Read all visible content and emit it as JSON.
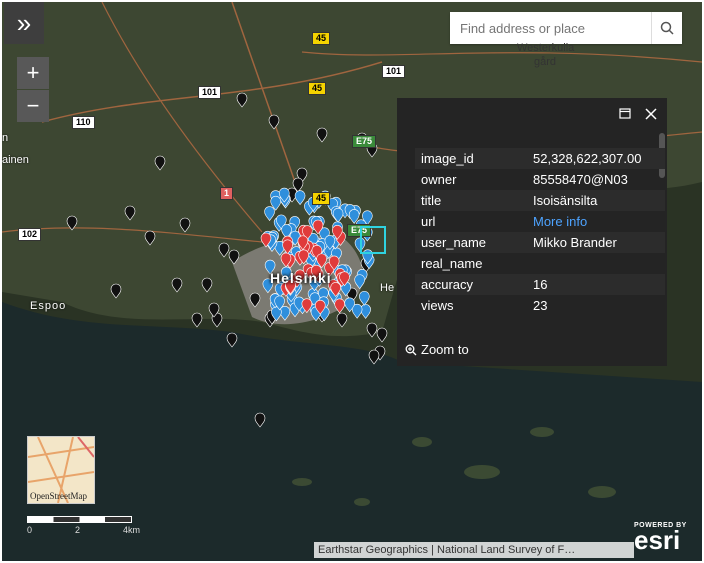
{
  "controls": {
    "expand_icon": "»",
    "zoom_in": "+",
    "zoom_out": "−"
  },
  "search": {
    "placeholder": "Find address or place"
  },
  "map_labels": {
    "helsinki": "Helsinki",
    "espoo": "Espoo",
    "westerkulla": "Westerkulla",
    "gard": "gård",
    "he": "He",
    "ainen": "ainen",
    "n": "n"
  },
  "road_shields": [
    "45",
    "101",
    "45",
    "101",
    "110",
    "45",
    "E75",
    "E75",
    "102",
    "1"
  ],
  "popup": {
    "rows": [
      {
        "key": "image_id",
        "value": "52,328,622,307.00"
      },
      {
        "key": "owner",
        "value": "85558470@N03"
      },
      {
        "key": "title",
        "value": "Isoisänsilta"
      },
      {
        "key": "url",
        "value": "More info"
      },
      {
        "key": "user_name",
        "value": "Mikko Brander"
      },
      {
        "key": "real_name",
        "value": ""
      },
      {
        "key": "accuracy",
        "value": "16"
      },
      {
        "key": "views",
        "value": "23"
      }
    ],
    "zoom_to": "Zoom to"
  },
  "basemap": {
    "label": "OpenStreetMap"
  },
  "scalebar": {
    "labels": [
      "0",
      "2",
      "4km"
    ]
  },
  "attribution": "Earthstar Geographics | National Land Survey of F…",
  "esri": {
    "powered": "POWERED BY",
    "logo": "esri"
  },
  "colors": {
    "marker_blue": "#2f8fdc",
    "marker_red": "#e03b3b",
    "marker_black": "#111111",
    "popup_bg": "#242424",
    "link": "#4da3ff"
  }
}
